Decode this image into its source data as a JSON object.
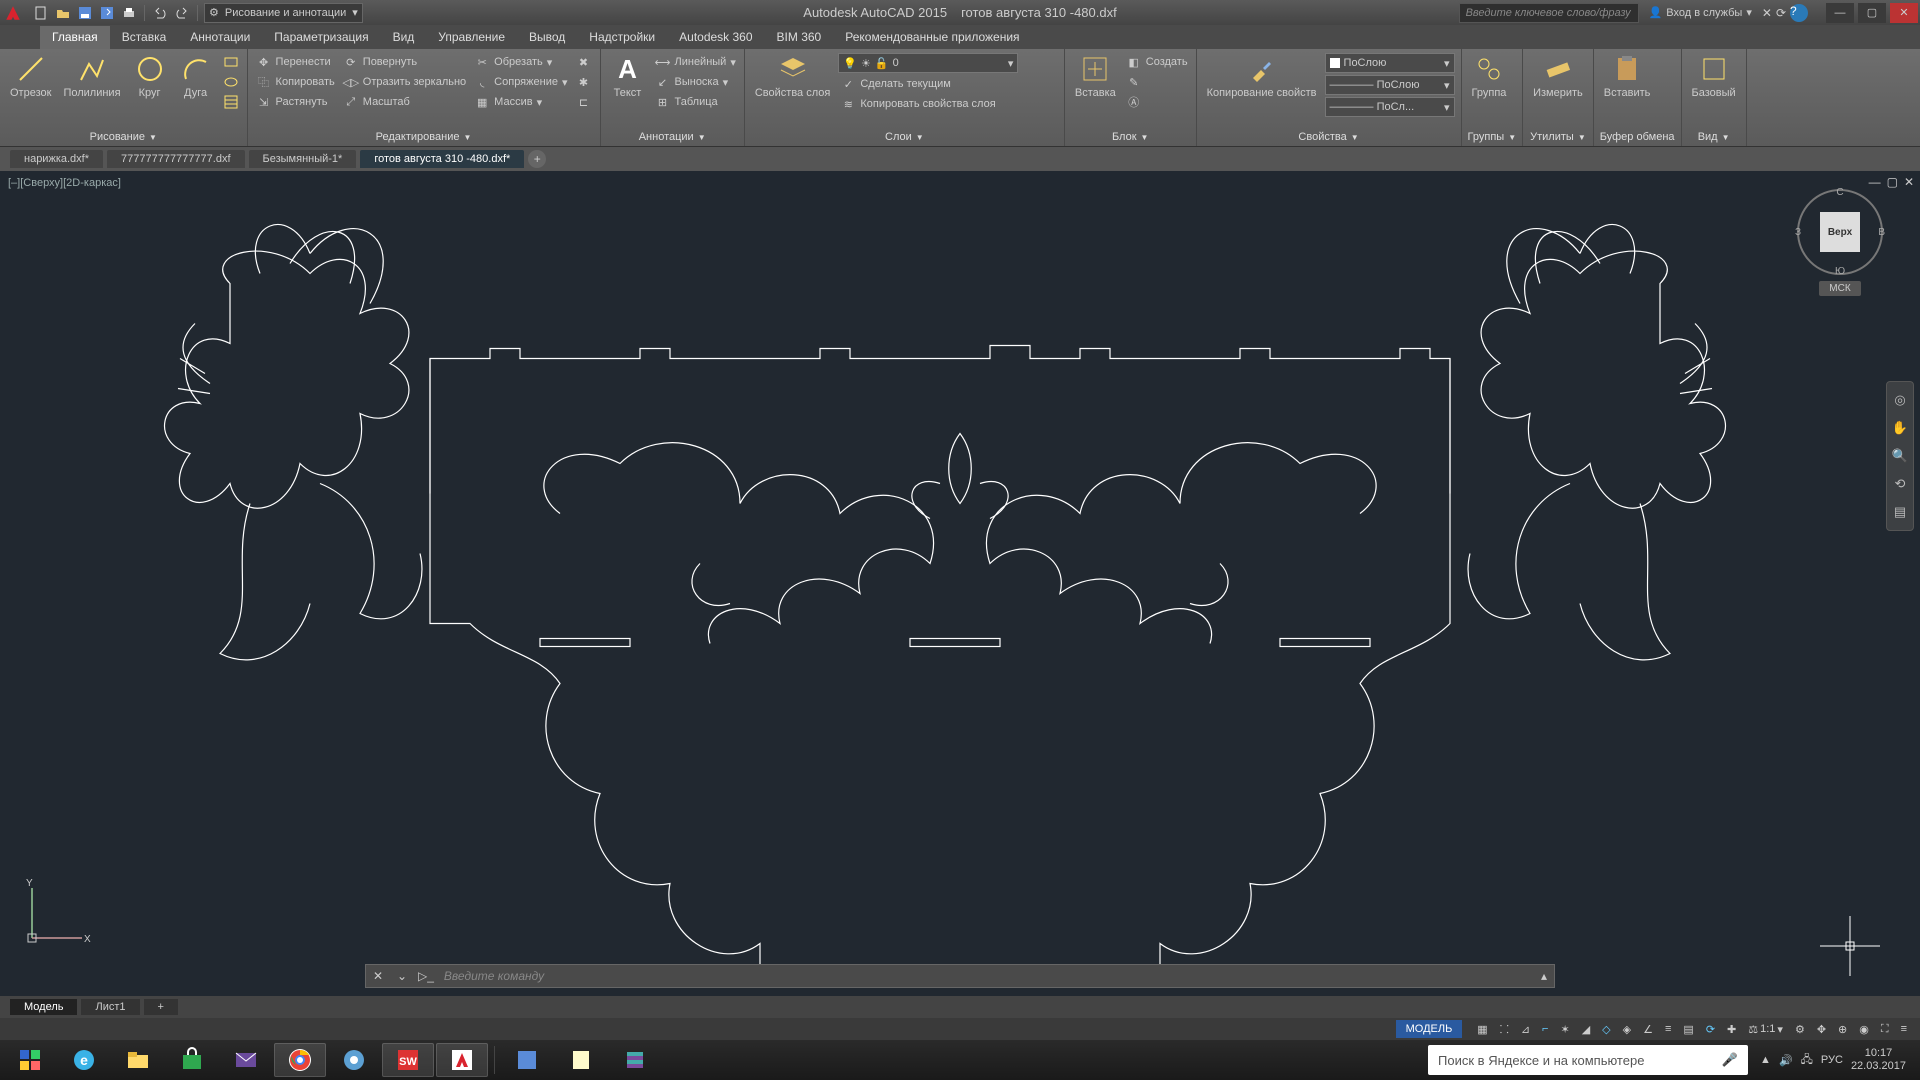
{
  "app": {
    "name": "Autodesk AutoCAD 2015",
    "document": "готов августа 310 -480.dxf"
  },
  "workspace": {
    "label": "Рисование и аннотации"
  },
  "search": {
    "placeholder": "Введите ключевое слово/фразу"
  },
  "signin": {
    "label": "Вход в службы"
  },
  "ribbon_tabs": [
    "Главная",
    "Вставка",
    "Аннотации",
    "Параметризация",
    "Вид",
    "Управление",
    "Вывод",
    "Надстройки",
    "Autodesk 360",
    "BIM 360",
    "Рекомендованные приложения"
  ],
  "ribbon_active": 0,
  "panels": {
    "draw": {
      "title": "Рисование",
      "line": "Отрезок",
      "polyline": "Полилиния",
      "circle": "Круг",
      "arc": "Дуга"
    },
    "modify": {
      "title": "Редактирование",
      "move": "Перенести",
      "rotate": "Повернуть",
      "trim": "Обрезать",
      "copy": "Копировать",
      "mirror": "Отразить зеркально",
      "fillet": "Сопряжение",
      "stretch": "Растянуть",
      "scale": "Масштаб",
      "array": "Массив"
    },
    "annot": {
      "title": "Аннотации",
      "text": "Текст",
      "linear": "Линейный",
      "leader": "Выноска",
      "table": "Таблица"
    },
    "layers": {
      "title": "Слои",
      "props": "Свойства слоя",
      "current": "Сделать текущим",
      "copy_props": "Копировать свойства слоя",
      "combo": "0"
    },
    "block": {
      "title": "Блок",
      "insert": "Вставка",
      "create": "Создать"
    },
    "props": {
      "title": "Свойства",
      "match": "Копирование свойств",
      "layer_combo": "ПоСлою",
      "lt_combo": "———— ПоСлою",
      "lw_combo": "———— ПоСл..."
    },
    "groups": {
      "title": "Группы",
      "group": "Группа"
    },
    "utils": {
      "title": "Утилиты",
      "measure": "Измерить"
    },
    "clip": {
      "title": "Буфер обмена",
      "paste": "Вставить"
    },
    "view": {
      "title": "Вид",
      "base": "Базовый"
    }
  },
  "file_tabs": [
    {
      "label": "нарижка.dxf*",
      "active": false
    },
    {
      "label": "777777777777777.dxf",
      "active": false
    },
    {
      "label": "Безымянный-1*",
      "active": false
    },
    {
      "label": "готов августа 310 -480.dxf*",
      "active": true
    }
  ],
  "viewport": {
    "label": "[–][Сверху][2D-каркас]"
  },
  "viewcube": {
    "face": "Верх",
    "n": "С",
    "s": "Ю",
    "e": "В",
    "w": "З",
    "wcs": "МСК"
  },
  "cmdline": {
    "placeholder": "Введите команду"
  },
  "layout_tabs": [
    {
      "label": "Модель",
      "active": true
    },
    {
      "label": "Лист1",
      "active": false
    }
  ],
  "status": {
    "model": "МОДЕЛЬ",
    "scale": "1:1"
  },
  "win_search": {
    "placeholder": "Поиск в Яндексе и на компьютере"
  },
  "tray": {
    "lang": "РУС",
    "time": "10:17",
    "date": "22.03.2017"
  }
}
